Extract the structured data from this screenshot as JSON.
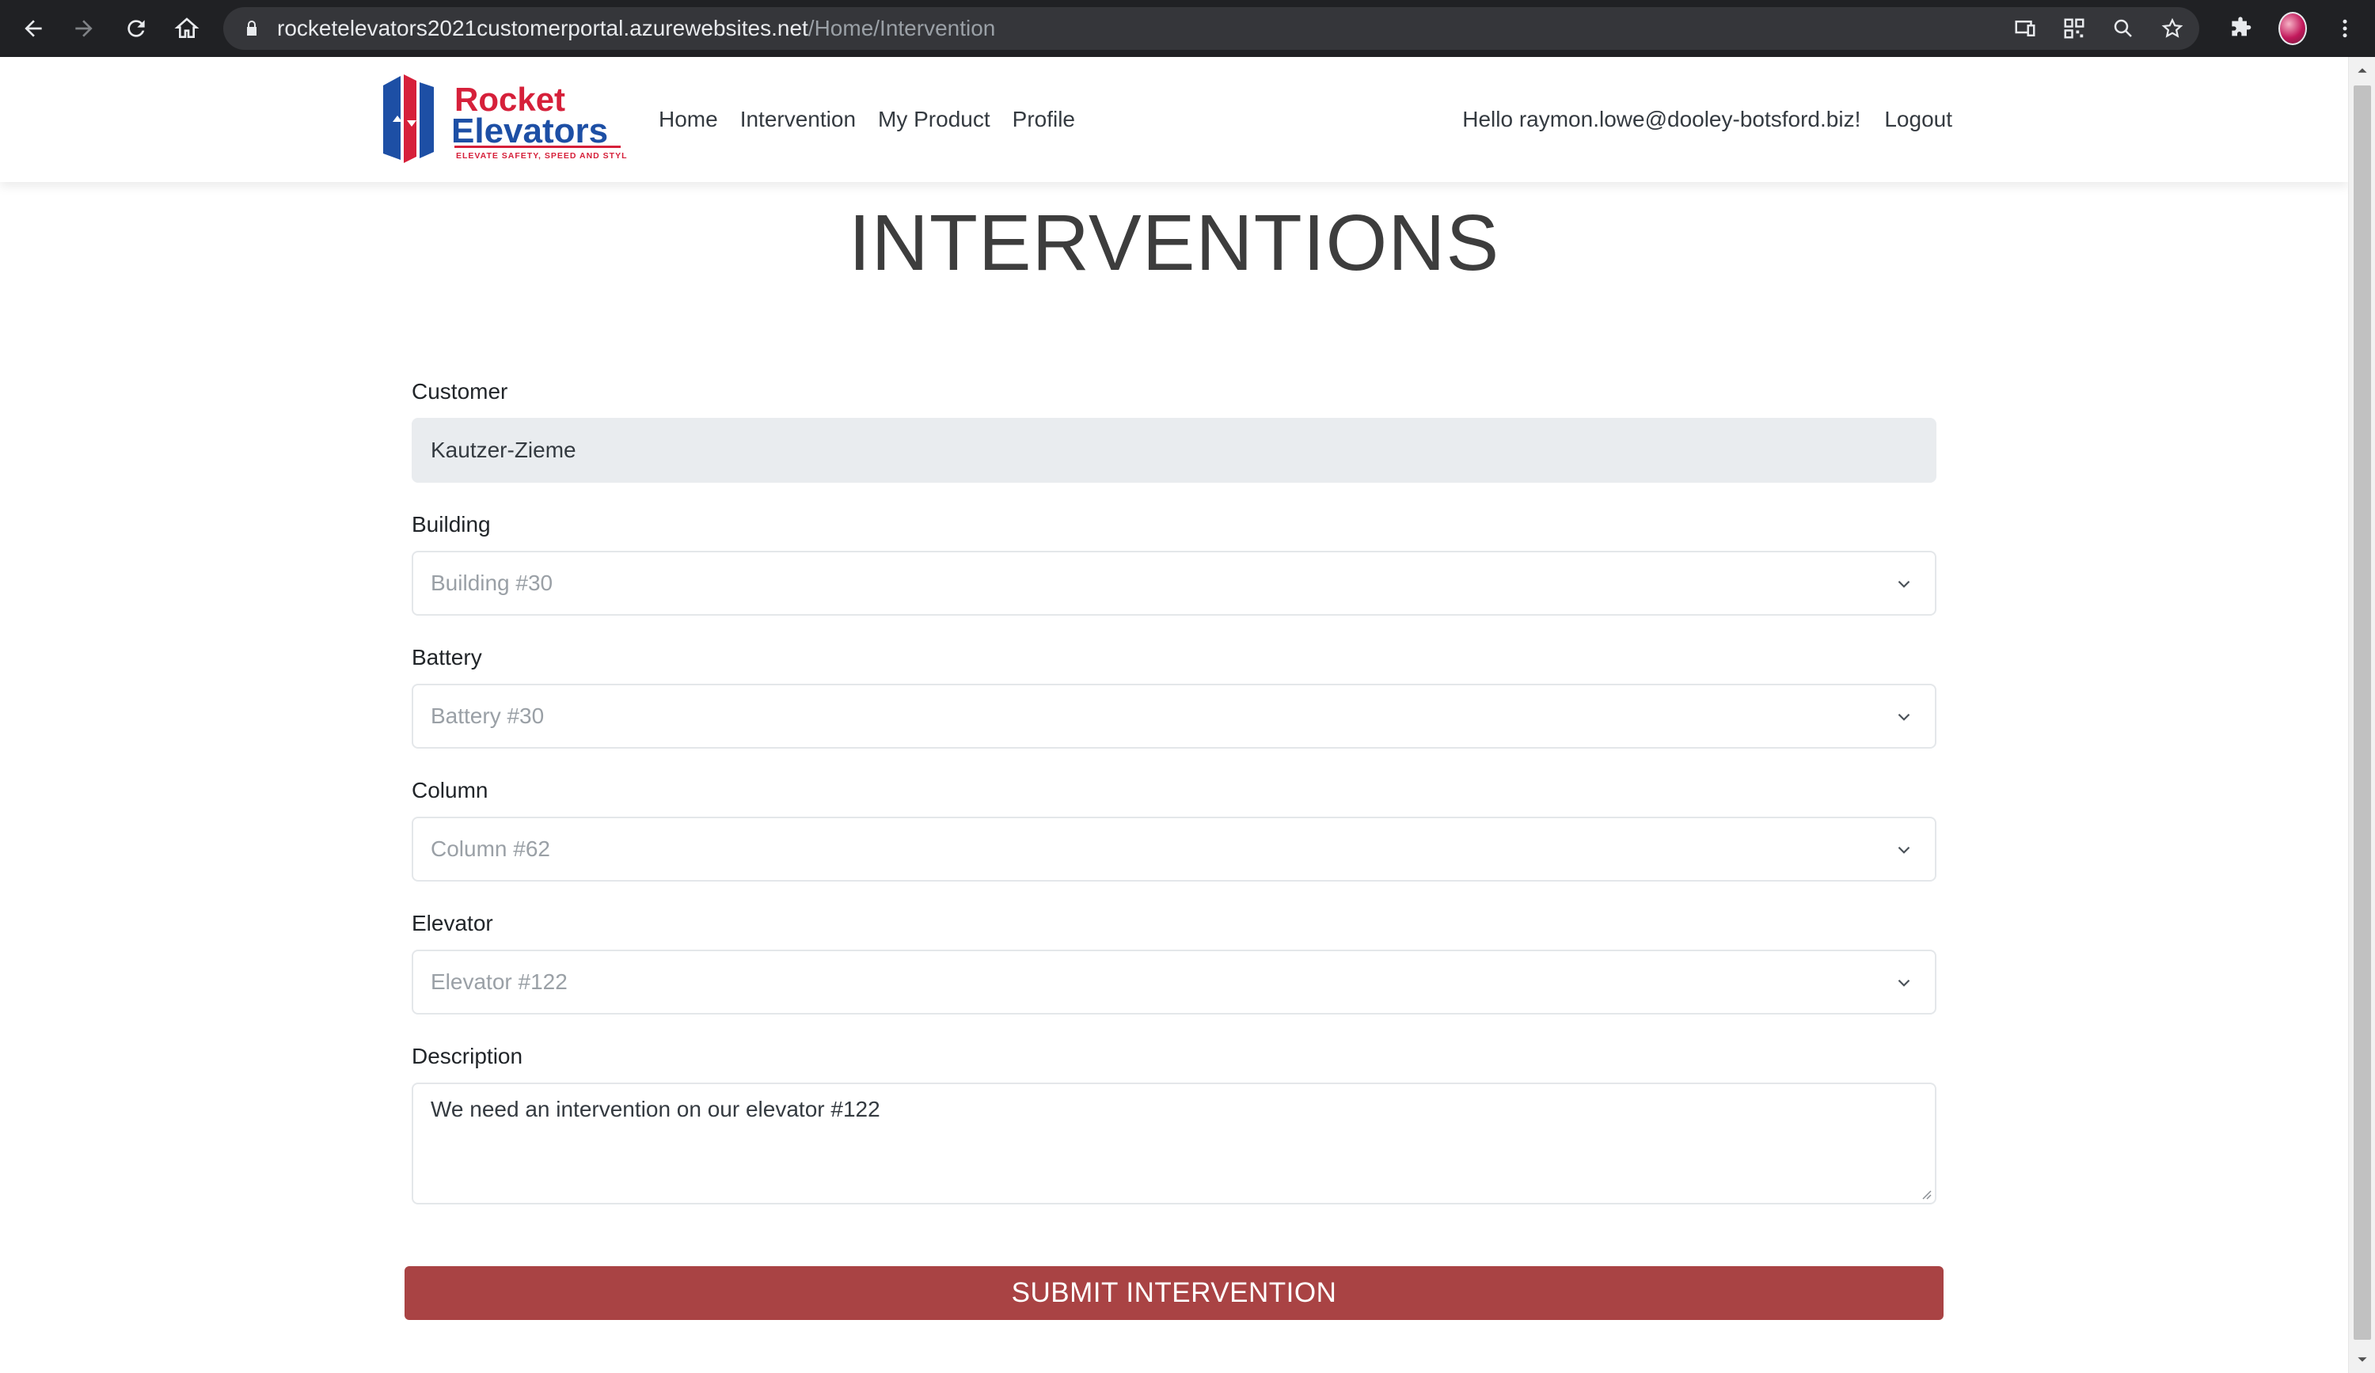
{
  "browser": {
    "url_host": "rocketelevators2021customerportal.azurewebsites.net",
    "url_path": "/Home/Intervention"
  },
  "nav": {
    "logo_text_top": "Rocket",
    "logo_text_bottom": "Elevators",
    "logo_tagline": "ELEVATE SAFETY, SPEED AND STYLE",
    "links": [
      "Home",
      "Intervention",
      "My Product",
      "Profile"
    ],
    "greeting": "Hello raymon.lowe@dooley-botsford.biz!",
    "logout": "Logout"
  },
  "page": {
    "title": "INTERVENTIONS"
  },
  "form": {
    "customer_label": "Customer",
    "customer_value": "Kautzer-Zieme",
    "building_label": "Building",
    "building_value": "Building #30",
    "battery_label": "Battery",
    "battery_value": "Battery #30",
    "column_label": "Column",
    "column_value": "Column #62",
    "elevator_label": "Elevator",
    "elevator_value": "Elevator #122",
    "description_label": "Description",
    "description_value": "We need an intervention on our elevator #122",
    "submit_label": "SUBMIT INTERVENTION"
  },
  "colors": {
    "submit": "#a94344",
    "brand_red": "#d6203a",
    "brand_blue": "#1d4fa5"
  }
}
